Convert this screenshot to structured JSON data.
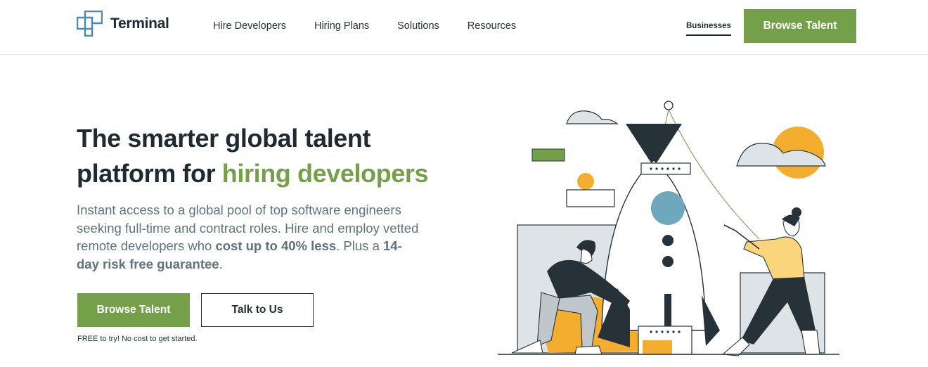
{
  "brand": {
    "name": "Terminal",
    "logo_icon": "terminal-cross-logo"
  },
  "nav": {
    "items": [
      {
        "label": "Hire Developers"
      },
      {
        "label": "Hiring Plans"
      },
      {
        "label": "Solutions"
      },
      {
        "label": "Resources"
      }
    ],
    "businesses_label": "Businesses",
    "cta_label": "Browse Talent"
  },
  "hero": {
    "headline_part1": "The smarter global talent platform for ",
    "headline_accent": "hiring developers",
    "lead_part1": "Instant access to a global pool of top software engineers seeking full-time and contract roles. Hire and employ vetted remote developers who ",
    "lead_bold1": "cost up to 40% less",
    "lead_part2": ". Plus a ",
    "lead_bold2": "14-day risk free guarantee",
    "lead_part3": ".",
    "primary_cta": "Browse Talent",
    "secondary_cta": "Talk to Us",
    "note": "FREE to try! No cost to get started."
  },
  "colors": {
    "accent": "#74a04a",
    "dark": "#263238",
    "muted": "#5f737d",
    "yellow": "#f3ad2f",
    "blue": "#6fa8bd",
    "shirt": "#fbd57b"
  }
}
